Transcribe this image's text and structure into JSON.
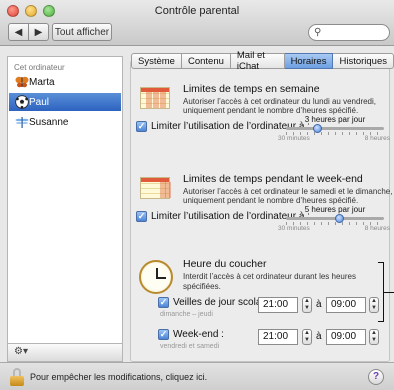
{
  "window": {
    "title": "Contrôle parental"
  },
  "toolbar": {
    "back": "◀",
    "forward": "▶",
    "show_all": "Tout afficher",
    "search_placeholder": ""
  },
  "sidebar": {
    "heading": "Cet ordinateur",
    "items": [
      {
        "label": "Marta",
        "icon": "butterfly-icon"
      },
      {
        "label": "Paul",
        "icon": "soccer-ball-icon"
      },
      {
        "label": "Susanne",
        "icon": "dragonfly-icon"
      }
    ],
    "gear": "⚙▾"
  },
  "tabs": [
    "Système",
    "Contenu",
    "Mail et iChat",
    "Horaires",
    "Historiques"
  ],
  "weekdays": {
    "title": "Limites de temps en semaine",
    "desc1": "Autoriser l’accès à cet ordinateur du lundi au vendredi,",
    "desc2": "uniquement pendant le nombre d’heures spécifié.",
    "checkbox": "Limiter l’utilisation de l’ordinateur à :",
    "slider_value": "3 heures par jour",
    "slider_level": 0.3,
    "min": "30 minutes",
    "max": "8 heures"
  },
  "weekend": {
    "title": "Limites de temps pendant le week-end",
    "desc1": "Autoriser l’accès à cet ordinateur le samedi et le dimanche,",
    "desc2": "uniquement pendant le nombre d’heures spécifié.",
    "checkbox": "Limiter l’utilisation de l’ordinateur à :",
    "slider_value": "5 heures par jour",
    "slider_level": 0.55,
    "min": "30 minutes",
    "max": "8 heures"
  },
  "bedtime": {
    "title": "Heure du coucher",
    "desc": "Interdit l’accès à cet ordinateur durant les heures spécifiées.",
    "school": {
      "label": "Veilles de jour scolaire :",
      "sub": "dimanche – jeudi",
      "from": "21:00",
      "to": "09:00"
    },
    "weekend": {
      "label": "Week-end :",
      "sub": "vendredi et samedi",
      "from": "21:00",
      "to": "09:00"
    },
    "a": "à"
  },
  "footer": {
    "lock_text": "Pour empêcher les modifications, cliquez ici.",
    "help": "?"
  }
}
